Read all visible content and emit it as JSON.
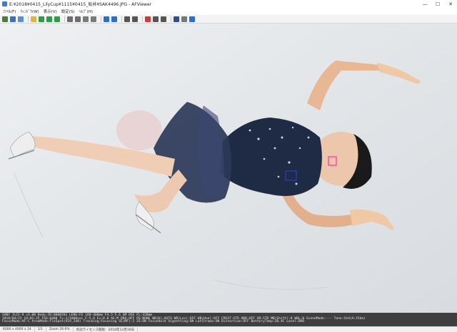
{
  "window": {
    "title": "E:¥2018¥0415_LilyCup¥1115¥0415_坂井¥SAK4496.JPG - AFViewer",
    "minimize": "—",
    "maximize": "☐",
    "close": "✕"
  },
  "menu": {
    "items": [
      "ﾌｧｲﾙ(F)",
      "ｳｨﾝﾄﾞｳ(W)",
      "表示(V)",
      "設定(S)",
      "ﾍﾙﾌﾟ(H)"
    ]
  },
  "toolbar": {
    "buttons": [
      {
        "icon": "thumbnail-icon",
        "color": "#4a7d3a"
      },
      {
        "icon": "image-icon",
        "color": "#3e6fb8"
      },
      {
        "icon": "page-icon",
        "color": "#5c8fcf"
      },
      {
        "icon": "folder-icon",
        "color": "#e2b341"
      },
      {
        "icon": "open-icon",
        "color": "#2f9b4a"
      },
      {
        "icon": "back-icon",
        "color": "#2e9d48"
      },
      {
        "icon": "forward-icon",
        "color": "#2e9d48"
      },
      {
        "icon": "zoom-in-icon",
        "color": "#6e6e6e"
      },
      {
        "icon": "zoom-out-icon",
        "color": "#6e6e6e"
      },
      {
        "icon": "fit-icon",
        "color": "#7a7a7a"
      },
      {
        "icon": "actual-size-icon",
        "color": "#7a7a7a"
      },
      {
        "icon": "rotate-left-icon",
        "color": "#2a6fc9"
      },
      {
        "icon": "rotate-right-icon",
        "color": "#2a6fc9"
      },
      {
        "icon": "grid-icon",
        "color": "#555555"
      },
      {
        "icon": "list-icon",
        "color": "#555555"
      },
      {
        "icon": "delete-icon",
        "color": "#d03a3a"
      },
      {
        "icon": "sort-icon",
        "color": "#555555"
      },
      {
        "icon": "rating-icon",
        "color": "#555555"
      },
      {
        "icon": "user-icon",
        "color": "#2f4f8f"
      },
      {
        "icon": "settings-icon",
        "color": "#777777"
      },
      {
        "icon": "help-icon",
        "color": "#2a6fc9"
      }
    ]
  },
  "af_points": {
    "primary_color": "#ff2ea6",
    "secondary_color": "#2a3ad4"
  },
  "info": {
    "lines": [
      "SONY ILCE-9 v3.00  Body:ID:0000201  LENS:FE 100-400mm F4.5-5.6 GM OSS  FL:320mm",
      "2018/04/15 18:01:25  ISO:6400  Tv:1/1000sec  F:5.6  Ev:0.0  AE:M  DRO:OFF  PS:NONE  WB(K):AUTO  WB(Lev):OFF  WB(Hue):OFF  CREAT:STD  HDR:OFF  VB:STD  MB(Shift):0  WBL:0  SceneMode:---  Tone:Std(A:25da)",
      "FocusMode:AF-C  AreaMode:FlxSpot(419,240)  Tracking:Focusing  SE(MF):2  ZS:ON  FocusHold  Vignetting:ON  LatChroma:ON  Distortion:OFF  BatteryTemp:20.4C  Level:DRO"
    ]
  },
  "status": {
    "resolution": "6000 x 4000 x 24",
    "index": "1/1",
    "zoom": "Zoom 26.6%",
    "extra": "有効ライセンス期限：2018年12月30日"
  }
}
